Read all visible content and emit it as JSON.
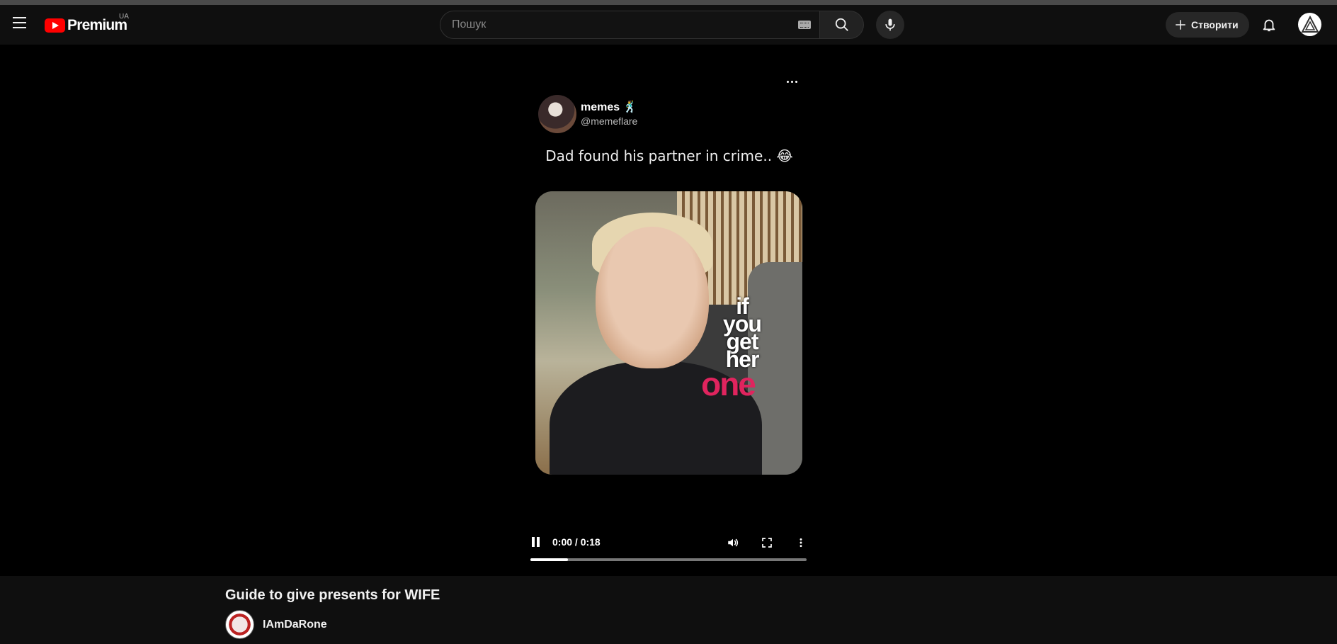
{
  "header": {
    "logo_text": "Premium",
    "country_code": "UA",
    "search_placeholder": "Пошук",
    "create_label": "Створити",
    "icons": {
      "menu": "hamburger-menu-icon",
      "keyboard": "keyboard-icon",
      "search": "search-icon",
      "mic": "microphone-icon",
      "create": "plus-icon",
      "notifications": "bell-icon",
      "account": "account-avatar-icon"
    }
  },
  "post": {
    "author_name": "memes 🕺",
    "author_handle": "@memeflare",
    "text": "Dad found his partner in crime.. 😂",
    "media_caption_white": [
      "if",
      "you",
      "get",
      "her"
    ],
    "media_caption_red": "one"
  },
  "player": {
    "time_display": "0:00 / 0:18",
    "progress_fraction": 0.137,
    "state": "playing"
  },
  "video": {
    "title": "Guide to give presents for WIFE",
    "channel_name": "IAmDaRone"
  },
  "colors": {
    "brand_red": "#ff0000",
    "caption_red": "#e0245e",
    "background": "#000000",
    "header_bg": "#0f0f0f"
  }
}
